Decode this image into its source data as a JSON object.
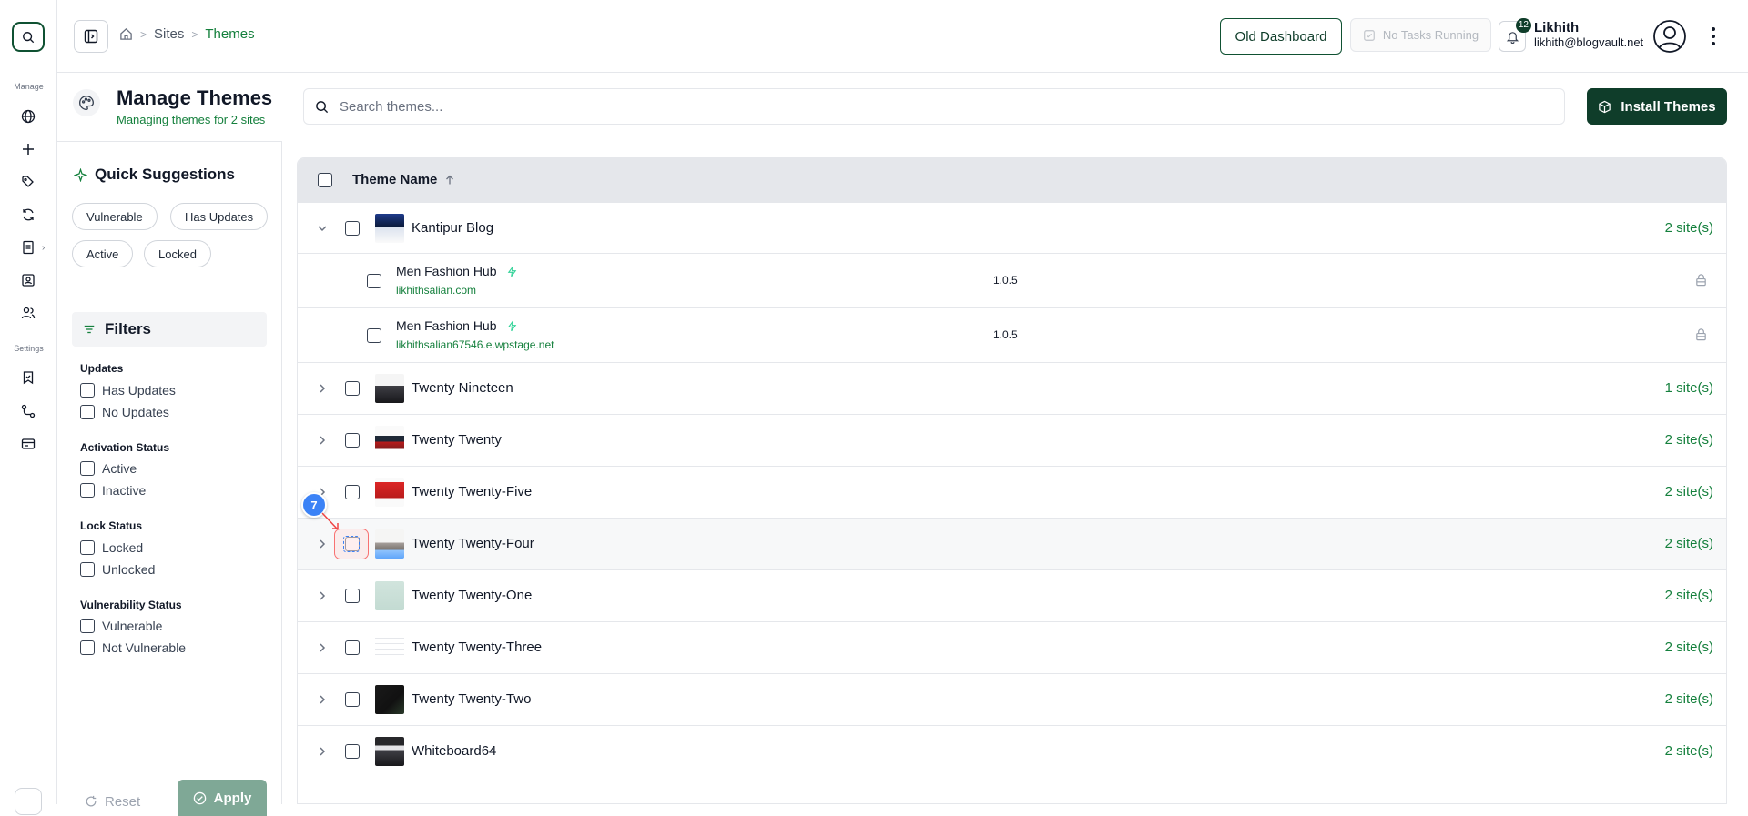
{
  "header": {
    "breadcrumb": [
      "Sites",
      "Themes"
    ],
    "old_dashboard_label": "Old Dashboard",
    "tasks_label": "No Tasks Running",
    "notification_count": "12",
    "user_name": "Likhith",
    "user_email": "likhith@blogvault.net"
  },
  "rail": {
    "manage_label": "Manage",
    "settings_label": "Settings"
  },
  "page": {
    "title": "Manage Themes",
    "subtitle": "Managing themes for 2 sites",
    "search_placeholder": "Search themes...",
    "install_label": "Install Themes"
  },
  "quick_suggestions": {
    "title": "Quick Suggestions",
    "chips": [
      "Vulnerable",
      "Has Updates",
      "Active",
      "Locked"
    ]
  },
  "filters": {
    "title": "Filters",
    "groups": [
      {
        "title": "Updates",
        "options": [
          "Has Updates",
          "No Updates"
        ]
      },
      {
        "title": "Activation Status",
        "options": [
          "Active",
          "Inactive"
        ]
      },
      {
        "title": "Lock Status",
        "options": [
          "Locked",
          "Unlocked"
        ]
      },
      {
        "title": "Vulnerability Status",
        "options": [
          "Vulnerable",
          "Not Vulnerable"
        ]
      }
    ],
    "reset_label": "Reset",
    "apply_label": "Apply"
  },
  "table": {
    "column_header": "Theme Name",
    "rows": [
      {
        "name": "Kantipur Blog",
        "sites": "2 site(s)",
        "expanded": true
      },
      {
        "name": "Twenty Nineteen",
        "sites": "1 site(s)"
      },
      {
        "name": "Twenty Twenty",
        "sites": "2 site(s)"
      },
      {
        "name": "Twenty Twenty-Five",
        "sites": "2 site(s)"
      },
      {
        "name": "Twenty Twenty-Four",
        "sites": "2 site(s)"
      },
      {
        "name": "Twenty Twenty-One",
        "sites": "2 site(s)"
      },
      {
        "name": "Twenty Twenty-Three",
        "sites": "2 site(s)"
      },
      {
        "name": "Twenty Twenty-Two",
        "sites": "2 site(s)"
      },
      {
        "name": "Whiteboard64",
        "sites": "2 site(s)"
      }
    ],
    "child_rows": [
      {
        "name": "Men Fashion Hub",
        "url": "likhithsalian.com",
        "version": "1.0.5"
      },
      {
        "name": "Men Fashion Hub",
        "url": "likhithsalian67546.e.wpstage.net",
        "version": "1.0.5"
      }
    ]
  },
  "annotation": {
    "step": "7"
  },
  "colors": {
    "brand": "#0f3d2a",
    "accent_green": "#15803d",
    "marker_blue": "#3b82f6"
  }
}
